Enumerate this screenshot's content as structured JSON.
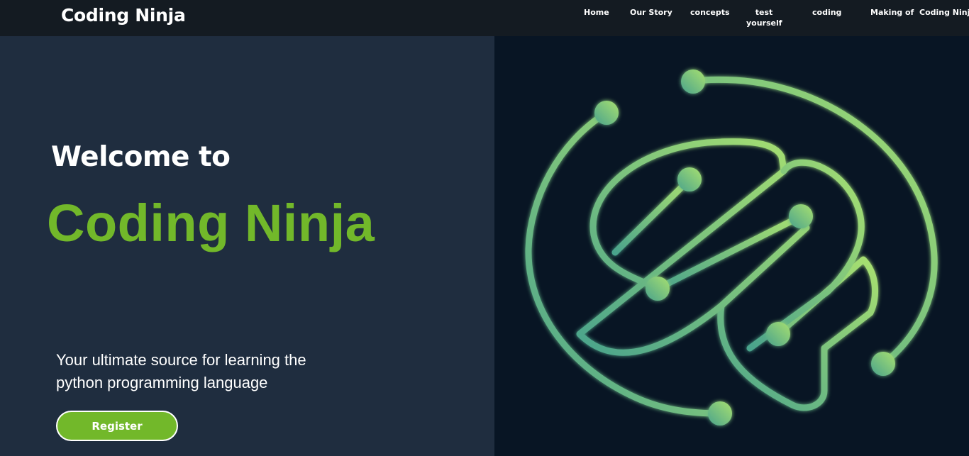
{
  "header": {
    "brand": "Coding Ninja",
    "nav": [
      {
        "label": "Home"
      },
      {
        "label": "Our Story"
      },
      {
        "label": "concepts"
      },
      {
        "label": "test\nyourself"
      },
      {
        "label": "coding"
      },
      {
        "label": "Making of  Coding Ninja"
      }
    ]
  },
  "hero": {
    "welcome": "Welcome to",
    "title": "Coding Ninja",
    "tagline": "Your ultimate source for learning the python programming language",
    "register_label": "Register"
  },
  "colors": {
    "nav_bg": "#141b22",
    "left_bg": "#1f2d3f",
    "right_bg": "#081524",
    "accent": "#72b82a",
    "logo_gradient_start": "#4aa38c",
    "logo_gradient_end": "#a8e070"
  },
  "icons": {
    "hero_image": "circuit-brain-icon"
  }
}
